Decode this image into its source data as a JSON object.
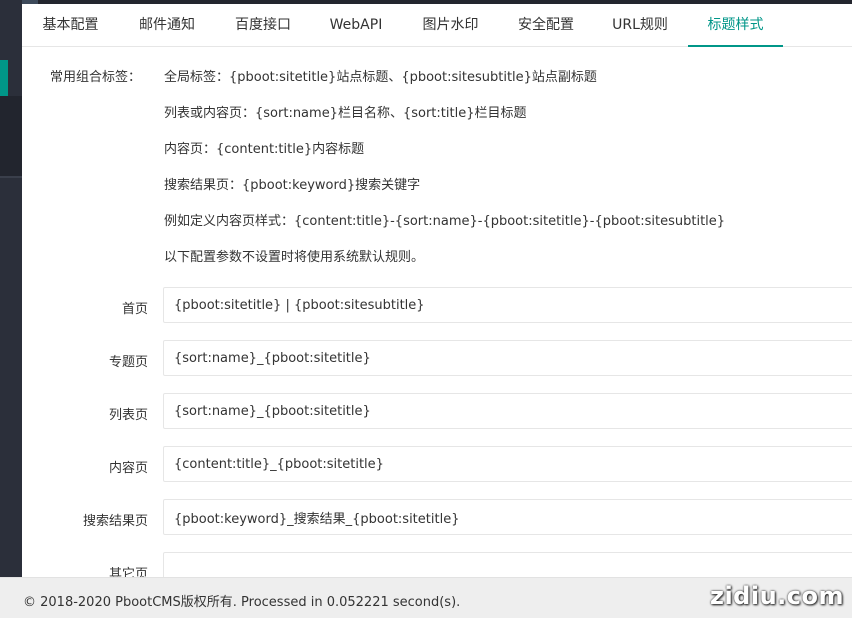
{
  "tabs": [
    {
      "label": "基本配置"
    },
    {
      "label": "邮件通知"
    },
    {
      "label": "百度接口"
    },
    {
      "label": "WebAPI"
    },
    {
      "label": "图片水印"
    },
    {
      "label": "安全配置"
    },
    {
      "label": "URL规则"
    },
    {
      "label": "标题样式"
    }
  ],
  "active_tab": "标题样式",
  "combo": {
    "label": "常用组合标签：",
    "lines": [
      "全局标签：{pboot:sitetitle}站点标题、{pboot:sitesubtitle}站点副标题",
      "列表或内容页：{sort:name}栏目名称、{sort:title}栏目标题",
      "内容页：{content:title}内容标题",
      "搜索结果页：{pboot:keyword}搜索关键字",
      "例如定义内容页样式：{content:title}-{sort:name}-{pboot:sitetitle}-{pboot:sitesubtitle}",
      "以下配置参数不设置时将使用系统默认规则。"
    ]
  },
  "fields": [
    {
      "label": "首页",
      "value": "{pboot:sitetitle} | {pboot:sitesubtitle}"
    },
    {
      "label": "专题页",
      "value": "{sort:name}_{pboot:sitetitle}"
    },
    {
      "label": "列表页",
      "value": "{sort:name}_{pboot:sitetitle}"
    },
    {
      "label": "内容页",
      "value": "{content:title}_{pboot:sitetitle}"
    },
    {
      "label": "搜索结果页",
      "value": "{pboot:keyword}_搜索结果_{pboot:sitetitle}"
    },
    {
      "label": "其它页",
      "value": ""
    }
  ],
  "footer": {
    "text": "© 2018-2020 PbootCMS版权所有. Processed in 0.052221 second(s).",
    "watermark": "zidiu.com"
  },
  "colors": {
    "accent": "#009688",
    "sidebar": "#2b2f3a",
    "footer_bg": "#eeeeee"
  }
}
